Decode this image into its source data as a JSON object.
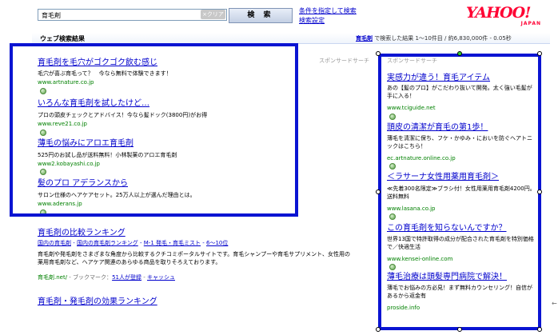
{
  "search": {
    "query": "育毛剤",
    "clear_label": "×クリア",
    "button_label": "検 索",
    "advanced_link": "条件を指定して検索",
    "settings_link": "検索設定"
  },
  "logo": {
    "main": "YAHOO!",
    "sub": "JAPAN",
    "color": "#ff0033"
  },
  "results_bar": {
    "title": "ウェブ検索結果",
    "keyword": "育毛剤",
    "summary": " で検索した結果 1〜10件目 / 約6,830,000件 - 0.05秒"
  },
  "sponsor_label": "スポンサードサーチ",
  "left_ads": [
    {
      "title": "育毛剤を毛穴がゴクゴク飲む感じ",
      "desc": "毛穴が喜ぶ育毛って？　今なら無料で体験できます！",
      "url": "www.artnature.co.jp"
    },
    {
      "title": "いろんな育毛剤を試したけど…",
      "desc": "プロの頭皮チェックとアドバイス！今なら髪ドック(3800円)がお得",
      "url": "www.reve21.co.jp"
    },
    {
      "title": "薄毛の悩みにアロエ育毛剤",
      "desc": "525円のお試し品が送料無料！小林製薬のアロエ育毛剤",
      "url": "www2.kobayashi.co.jp"
    },
    {
      "title": "髪のプロ アデランスから",
      "desc": "サロン仕様のヘアケアセット。25万人以上が選んだ理由とは。",
      "url": "www.aderans.jp"
    }
  ],
  "right_ads": [
    {
      "title": "実感力が違う！育毛アイテム",
      "desc": "あの【髪のプロ】がこだわり抜いて開発。太く強い毛髪が手に入る！",
      "url": "www.tciguide.net"
    },
    {
      "title": "頭皮の清潔が育毛の第1歩！",
      "desc": "薄毛を清潔に保ち、フケ・かゆみ・においを防ぐヘアトニックはこちら！",
      "url": "ec.artnature.online.co.jp"
    },
    {
      "title": "＜ラサーナ女性用薬用育毛剤＞",
      "desc": "≪先着300名限定≫ブラシ付！女性用薬用育毛剤4200円。送料無料",
      "url": "www.lasana.co.jp"
    },
    {
      "title": "この育毛剤を知らないんですか？",
      "desc": "世界13国で特許取得の成分が配合された育毛剤を特別価格で／快適生活",
      "url": "www.kensei-online.com"
    },
    {
      "title": "薄毛治療は頭髪専門病院で解決！",
      "desc": "薄毛でお悩みの方必見！まず無料カウンセリング！自信があるから返金有",
      "url": "proside.info"
    }
  ],
  "organic": [
    {
      "title": "育毛剤の比較ランキング",
      "sublinks": [
        "国内の育毛剤",
        "国内の育毛剤ランキング",
        "M-1 発毛・育毛ミスト",
        "6〜10位"
      ],
      "desc": "育毛剤や発毛剤をさまざまな角度から比較するクチコミポータルサイトです。育毛シャンプーや育毛サプリメント、女性用の薬用育毛剤など、ヘアケア関連のあらゆる商品を取りそろえております。",
      "url": "育毛剤.net/",
      "bookmark": "ブックマーク：",
      "bookmark_count": "51人が登録",
      "cache": "キャッシュ"
    },
    {
      "title": "育毛剤・発毛剤の効果ランキング"
    }
  ],
  "highlight_color": "#0a14d2"
}
